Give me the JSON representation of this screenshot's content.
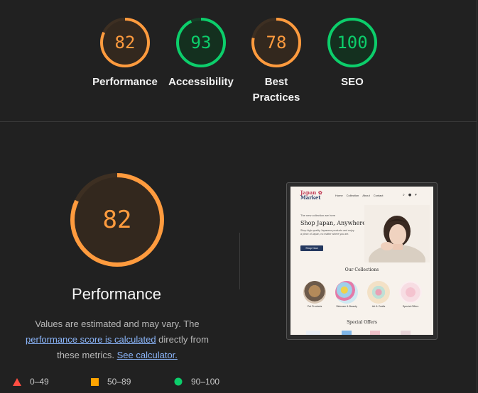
{
  "summary_gauges": [
    {
      "score": "82",
      "label_lines": [
        "Performance"
      ],
      "color": "#ff9b3e",
      "track": "#3d2f22",
      "fill": "#33281e",
      "fraction": 0.82
    },
    {
      "score": "93",
      "label_lines": [
        "Accessibility"
      ],
      "color": "#0cce6b",
      "track": "#173d27",
      "fill": "#14301f",
      "fraction": 0.93
    },
    {
      "score": "78",
      "label_lines": [
        "Best",
        "Practices"
      ],
      "color": "#ff9b3e",
      "track": "#3d2f22",
      "fill": "#33281e",
      "fraction": 0.78
    },
    {
      "score": "100",
      "label_lines": [
        "SEO"
      ],
      "color": "#0cce6b",
      "track": "#173d27",
      "fill": "#14301f",
      "fraction": 1.0
    }
  ],
  "main_gauge": {
    "score": "82",
    "title": "Performance",
    "fraction": 0.82,
    "color": "#ff9b3e"
  },
  "description": {
    "part1": "Values are estimated and may vary. The ",
    "link1": "performance score is calculated",
    "part2": " directly from these metrics. ",
    "link2": "See calculator."
  },
  "legend": [
    {
      "label": "0–49",
      "color": "#ff4e42",
      "shape": "triangle"
    },
    {
      "label": "50–89",
      "color": "#ffa400",
      "shape": "square"
    },
    {
      "label": "90–100",
      "color": "#0cce6b",
      "shape": "circle"
    }
  ],
  "thumbnail": {
    "logo_line1": "Japan",
    "logo_mark": "✿",
    "logo_line2": "Market",
    "nav": [
      "Home",
      "Collection",
      "About",
      "Contact"
    ],
    "kicker": "The new collection are here",
    "hero_title": "Shop Japan, Anywhere",
    "hero_text": "Shop high-quality Japanese products and enjoy a piece of Japan, no matter where you are.",
    "cta": "Shop Now",
    "collections_title": "Our Collections",
    "collections": [
      "Pet Products",
      "Skincare & Beauty",
      "Art & Crafts",
      "Special Offers"
    ],
    "offers_title": "Special Offers"
  }
}
